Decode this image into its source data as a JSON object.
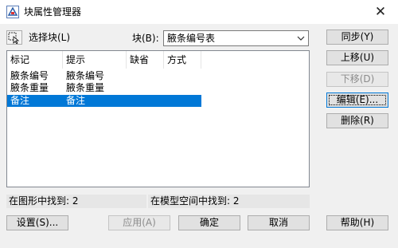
{
  "window": {
    "title": "块属性管理器",
    "close_glyph": "✕"
  },
  "toolbar": {
    "pick_block_label": "选择块(L)",
    "block_label": "块(B):",
    "block_value": "腋条编号表"
  },
  "attributes_table": {
    "columns": [
      "标记",
      "提示",
      "缺省",
      "方式"
    ],
    "rows": [
      {
        "tag": "腋条编号",
        "prompt": "腋条编号",
        "default": "",
        "mode": ""
      },
      {
        "tag": "腋条重量",
        "prompt": "腋条重量",
        "default": "",
        "mode": ""
      },
      {
        "tag": "备注",
        "prompt": "备注",
        "default": "",
        "mode": "",
        "selected": true
      }
    ]
  },
  "side_buttons": {
    "sync": "同步(Y)",
    "move_up": "上移(U)",
    "move_down": "下移(D)",
    "edit": "编辑(E)...",
    "remove": "删除(R)"
  },
  "status": {
    "found_in_drawing": "在图形中找到: 2",
    "found_in_modelspace": "在模型空间中找到: 2"
  },
  "bottom_buttons": {
    "settings": "设置(S)...",
    "apply": "应用(A)",
    "ok": "确定",
    "cancel": "取消",
    "help": "帮助(H)"
  },
  "colors": {
    "selection": "#0078d7",
    "dialog_bg": "#f0f0f0",
    "button_bg": "#e1e1e1"
  },
  "icons": {
    "app": "cad-block-attribute-icon",
    "pick": "pick-block-cursor-icon",
    "combo_arrow": "chevron-down-icon"
  }
}
